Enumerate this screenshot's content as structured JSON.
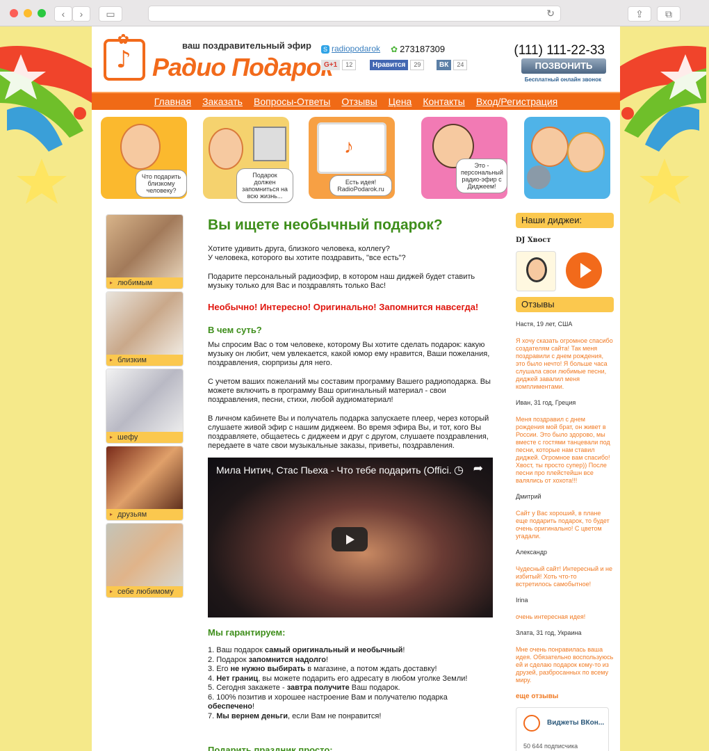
{
  "colors": {
    "accent": "#f26a1b",
    "green": "#3e8e1b",
    "yellow": "#fbc84e",
    "red": "#e0160e"
  },
  "header": {
    "tagline": "ваш поздравительный эфир",
    "brand": "Радио Подарок",
    "skype": "radiopodarok",
    "icq": "273187309",
    "phone": "(111) 111-22-33",
    "call_label": "ПОЗВОНИТЬ",
    "call_note": "Бесплатный онлайн звонок",
    "social": [
      {
        "label": "G+1",
        "count": "12"
      },
      {
        "label": "Нравится",
        "count": "29"
      },
      {
        "label": "ВК",
        "count": "24"
      }
    ]
  },
  "nav": [
    "Главная",
    "Заказать",
    "Вопросы-Ответы",
    "Отзывы",
    "Цена",
    "Контакты",
    "Вход/Регистрация"
  ],
  "banner": [
    "Что подарить близкому человеку?",
    "Подарок должен запомниться на всю жизнь...",
    "Есть идея! RadioPodarok.ru",
    "Это - персональный радио-эфир с Диджеем!"
  ],
  "sidebar": [
    "любимым",
    "близким",
    "шефу",
    "друзьям",
    "себе любимому"
  ],
  "main": {
    "title": "Вы ищете необычный подарок?",
    "p1a": "Хотите удивить друга, близкого человека, коллегу?",
    "p1b": "У человека, которого вы хотите поздравить, \"все есть\"?",
    "p2": "Подарите персональный радиоэфир, в котором наш диджей будет ставить музыку только для Вас и поздравлять только Вас!",
    "slogan": "Необычно! Интересно! Оригинально! Запомнится навсегда!",
    "h_essence": "В чем суть?",
    "p3": "Мы спросим Вас о том человеке, которому Вы хотите сделать подарок: какую музыку он любит, чем увлекается, какой юмор ему нравится, Ваши пожелания, поздравления, сюрпризы для него.",
    "p4": "С учетом ваших пожеланий мы составим программу Вашего радиоподарка. Вы можете включить в программу Ваш оригинальный материал - свои поздравления, песни, стихи, любой аудиоматериал!",
    "p5": "В личном кабинете Вы и получатель подарка запускаете плеер, через который слушаете живой эфир с нашим диджеем. Во время эфира Вы, и тот, кого Вы поздравляете, общаетесь с диджеем и друг с другом, слушаете поздравления, передаете в чате свои музыкальные заказы, приветы, поздравления.",
    "video_title": "Мила Нитич, Стас Пьеха - Что тебе подарить (Offici...",
    "h_guarantee": "Мы гарантируем:",
    "guarantees": [
      [
        "1. Ваш подарок ",
        "самый оригинальный и необычный",
        "!"
      ],
      [
        "2. Подарок ",
        "запомнится надолго",
        "!"
      ],
      [
        "3. Его ",
        "не нужно выбирать",
        " в магазине, а потом ждать доставку!"
      ],
      [
        "4. ",
        "Нет границ",
        ", вы можете подарить его адресату в любом уголке Земли!"
      ],
      [
        "5. Сегодня закажете - ",
        "завтра получите",
        " Ваш подарок."
      ],
      [
        "6. 100% позитив и хорошее настроение Вам и получателю подарка ",
        "обеспечено",
        "!"
      ],
      [
        "7. ",
        "Мы вернем деньги",
        ", если Вам не понравится!"
      ]
    ],
    "h_easy": "Подарить праздник просто:"
  },
  "right": {
    "djs_title": "Наши диджеи:",
    "dj_name": "DJ Хвост",
    "reviews_title": "Отзывы",
    "reviews": [
      {
        "name": "Настя, 19 лет, США",
        "text": "Я хочу сказать огромное спасибо создателям сайта! Так меня поздравили с днем рождения, это было нечто! Я больше часа слушала свои любимые песни, диджей завалил меня комплиментами."
      },
      {
        "name": "Иван, 31 год, Греция",
        "text": "Меня поздравил с днем рождения мой брат, он живет в России. Это было здорово, мы вместе с гостями танцевали под песни, которые нам ставил диджей. Огромное вам спасибо! Хвост, ты просто супер)) После песни про плейстейшн все валялись от хохота!!!"
      },
      {
        "name": "Дмитрий",
        "text": "Сайт у Вас хороший, в плане еще подарить подарок, то будет очень оригинально! С цветом угадали."
      },
      {
        "name": "Александр",
        "text": "Чудесный сайт! Интересный и не избитый! Хоть что-то встретилось самобытное!"
      },
      {
        "name": "Irina",
        "text": "очень интересная идея!"
      },
      {
        "name": "Злата, 31 год, Украина",
        "text": "Мне очень понравилась ваша идея. Обязательно воспользуюсь ей и сделаю подарок кому-то из друзей, разбросанных по всему миру."
      }
    ],
    "more": "еще отзывы",
    "vk_title": "Виджеты ВКон...",
    "vk_count": "50 644 подписчика"
  }
}
